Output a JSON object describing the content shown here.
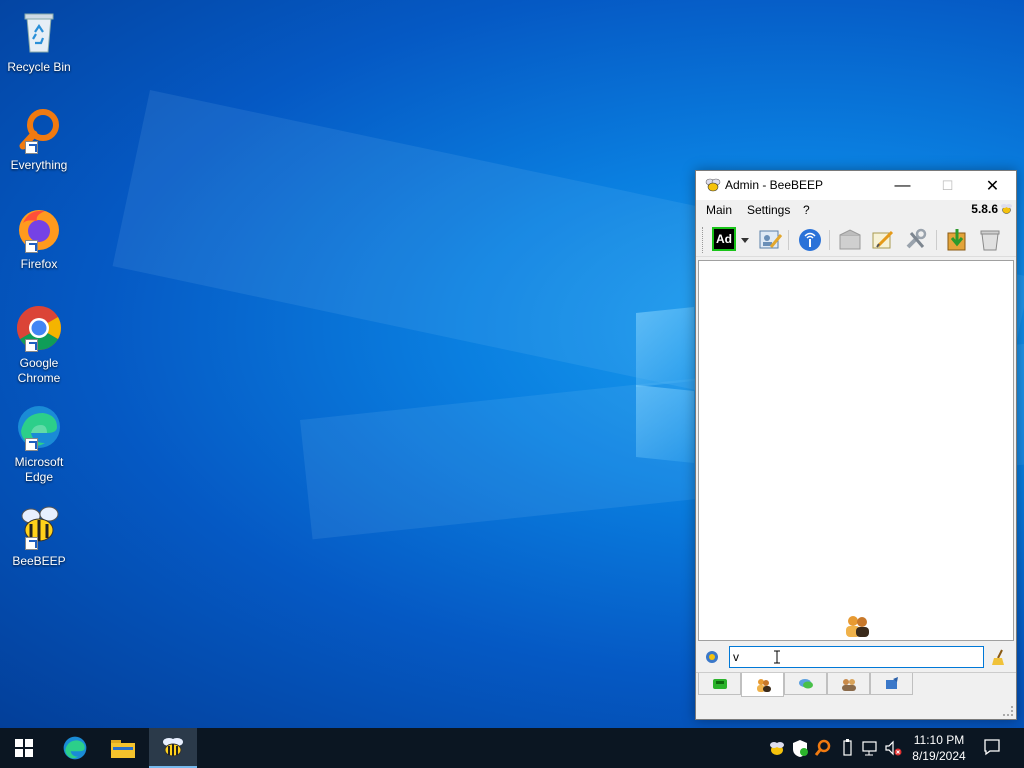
{
  "desktop": {
    "icons": [
      {
        "label": "Recycle Bin"
      },
      {
        "label": "Everything"
      },
      {
        "label": "Firefox"
      },
      {
        "label": "Google Chrome"
      },
      {
        "label": "Microsoft Edge"
      },
      {
        "label": "BeeBEEP"
      }
    ]
  },
  "window": {
    "title": "Admin - BeeBEEP",
    "controls": {
      "minimize": "—",
      "maximize": "☐",
      "close": "✕"
    },
    "menu": [
      "Main",
      "Settings",
      "?"
    ],
    "version": "5.8.6",
    "toolbar": {
      "status_badge": "Ad",
      "items": [
        "status-dropdown",
        "profile-edit",
        "network-broadcast",
        "mail",
        "edit-note",
        "settings-wrench",
        "download-update",
        "trash-clear"
      ]
    },
    "input": {
      "value": "v"
    },
    "tabs": [
      "users",
      "chats",
      "groups",
      "share"
    ]
  },
  "taskbar": {
    "clock_time": "11:10 PM",
    "clock_date": "8/19/2024"
  },
  "colors": {
    "accent": "#0078d7",
    "desktop": "#0a7fe0",
    "taskbar": "#0b1622"
  }
}
